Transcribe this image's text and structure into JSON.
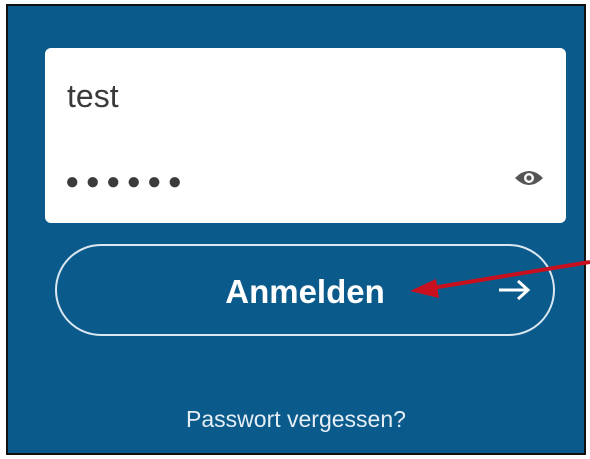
{
  "form": {
    "username_value": "test",
    "password_mask": "●●●●●●"
  },
  "icons": {
    "password_toggle": "eye-icon",
    "submit_arrow": "arrow-right-icon"
  },
  "buttons": {
    "login_label": "Anmelden"
  },
  "links": {
    "forgot_password": "Passwort vergessen?"
  },
  "colors": {
    "background": "#0a5a8c",
    "annotation_arrow": "#c8101e"
  }
}
